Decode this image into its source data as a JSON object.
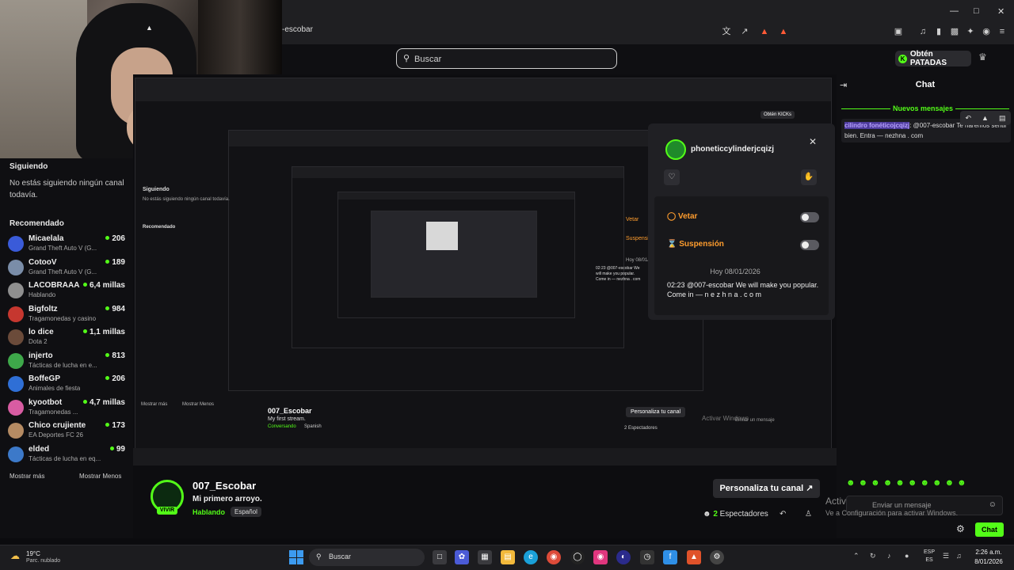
{
  "browser": {
    "url": "-escobar",
    "window_controls": [
      "minimize",
      "maximize",
      "close"
    ]
  },
  "header": {
    "search_placeholder": "Buscar",
    "cta_label": "Obtén PATADAS",
    "cta_icon": "K"
  },
  "sidebar": {
    "following_title": "Siguiendo",
    "following_empty": "No estás siguiendo ningún canal todavía.",
    "recommended_title": "Recomendado",
    "channels": [
      {
        "name": "Micaelala",
        "game": "Grand Theft Auto V (G...",
        "viewers": "206",
        "color": "#3a5bd9"
      },
      {
        "name": "CotooV",
        "game": "Grand Theft Auto V (G...",
        "viewers": "189",
        "color": "#7a8da8"
      },
      {
        "name": "LACOBRAAA",
        "game": "Hablando",
        "viewers": "6,4 millas",
        "color": "#8f8f8f"
      },
      {
        "name": "Bigfoltz",
        "game": "Tragamonedas y casino",
        "viewers": "984",
        "color": "#c6372f"
      },
      {
        "name": "lo dice",
        "game": "Dota 2",
        "viewers": "1,1 millas",
        "color": "#6b4b3a"
      },
      {
        "name": "injerto",
        "game": "Tácticas de lucha en e...",
        "viewers": "813",
        "color": "#3ea84a"
      },
      {
        "name": "BoffeGP",
        "game": "Animales de fiesta",
        "viewers": "206",
        "color": "#2f6fd6"
      },
      {
        "name": "kyootbot",
        "game": "Tragamonedas ...",
        "viewers": "4,7 millas",
        "color": "#d85ca2"
      },
      {
        "name": "Chico crujiente",
        "game": "EA Deportes FC 26",
        "viewers": "173",
        "color": "#b58b63"
      },
      {
        "name": "elded",
        "game": "Tácticas de lucha en eq...",
        "viewers": "99",
        "color": "#3c79c9"
      }
    ],
    "show_more": "Mostrar más",
    "show_less": "Mostrar Menos"
  },
  "popup": {
    "username": "phoneticcylinderjcqizj",
    "ban_label": "Vetar",
    "timeout_label": "Suspensión",
    "date": "Hoy 08/01/2026",
    "message": "02:23 @007-escobar We will make you popular. Come in — n e z h n a . c o m"
  },
  "stream": {
    "name": "007_Escobar",
    "title": "Mi primero arroyo.",
    "category": "Hablando",
    "language": "Español",
    "live_badge": "VIVIR",
    "customize_label": "Personaliza tu canal",
    "viewers_count": "2",
    "viewers_label": "Espectadores"
  },
  "chat": {
    "title": "Chat",
    "new_messages": "Nuevos mensajes",
    "message_user": "cilindro fonéticojcqizj",
    "message_text": ": @007-escobar Te haremos sentir bien. Entra — nezhna . com",
    "input_placeholder": "Enviar un mensaje",
    "send_label": "Chat",
    "emotes": "☻☻☻☻☻☻☻☻☻☻"
  },
  "windows": {
    "activate_title": "Activar Windows",
    "activate_sub": "Ve a Configuración para activar Windows.",
    "weather_temp": "19°C",
    "weather_desc": "Parc. nublado",
    "taskbar_search": "Buscar",
    "lang_top": "ESP",
    "lang_bottom": "ES",
    "time": "2:26 a.m.",
    "date": "8/01/2026"
  },
  "nested_capture": {
    "texts": [
      "Siguiendo",
      "No estás siguiendo ningún canal todavía.",
      "Recomendado",
      "007_Escobar",
      "My first stream.",
      "Conversando",
      "Spanish",
      "Personaliza tu canal",
      "2 Espectadores",
      "Obtén KICKs",
      "Vetar",
      "Suspensión",
      "Hoy 08/01/2026",
      "02:23 @007-escobar We will make you popular. Come in — nezhna . com",
      "Enviar un mensaje",
      "Activar Windows",
      "Mostrar más",
      "Mostrar Menos"
    ]
  }
}
